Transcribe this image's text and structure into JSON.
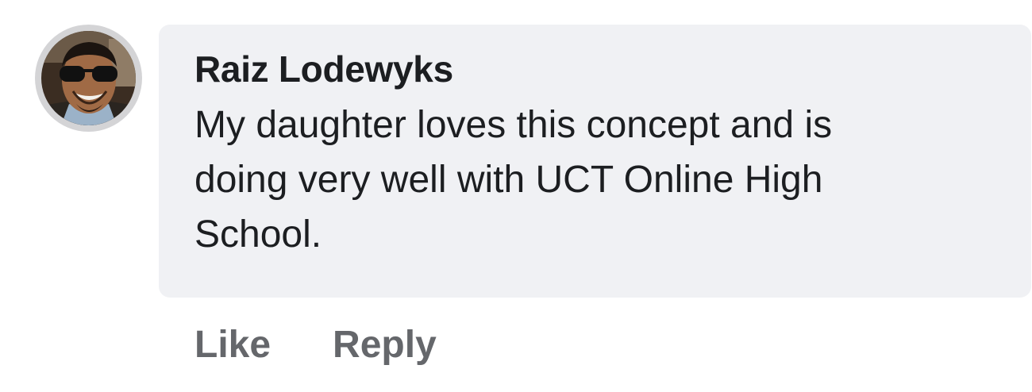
{
  "comment": {
    "author": "Raiz Lodewyks",
    "text": "My daughter loves this concept and is doing very well with UCT Online High School.",
    "avatar_icon": "user-avatar-photo"
  },
  "actions": {
    "like_label": "Like",
    "reply_label": "Reply"
  },
  "colors": {
    "bubble_background": "#f0f1f4",
    "text": "#1c1e21",
    "action_text": "#65676b",
    "avatar_ring": "#d4d4d6"
  }
}
